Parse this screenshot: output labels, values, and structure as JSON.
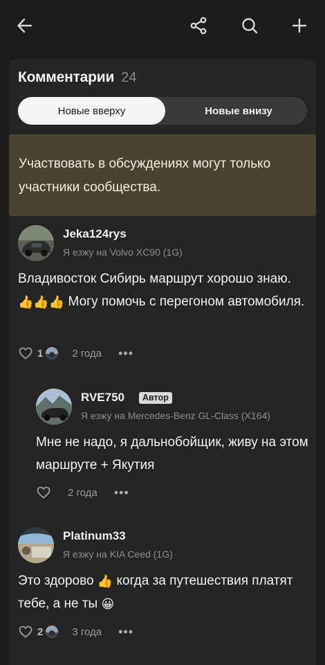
{
  "header": {
    "back_icon": "arrow-left-icon",
    "share_icon": "share-icon",
    "search_icon": "search-icon",
    "add_icon": "plus-icon"
  },
  "comments_section": {
    "title": "Комментарии",
    "count": "24",
    "sort": {
      "newest_first": "Новые вверху",
      "oldest_first": "Новые внизу",
      "selected": "Новые вверху"
    },
    "notice": "Участвовать в обсуждениях могут только участники сообщества."
  },
  "comments": [
    {
      "username": "Jeka124rys",
      "car": "Я езжу на Volvo XC90 (1G)",
      "text_a": "Владивосток Сибирь маршрут хорошо знаю.",
      "emoji_a": "👍👍👍",
      "text_b": " Могу помочь с перегоном автомобиля.",
      "likes": "1",
      "time": "2 года",
      "more": "•••"
    },
    {
      "username": "RVE750",
      "badge": "Автор",
      "car": "Я езжу на Mercedes-Benz GL-Class (X164)",
      "text": "Мне не надо, я дальнобойщик, живу на этом маршруте + Якутия",
      "time": "2 года",
      "more": "•••"
    },
    {
      "username": "Platinum33",
      "car": "Я езжу на KIA Ceed (1G)",
      "text_a": "Это здорово ",
      "emoji_a": "👍",
      "text_b": " когда за путешествия платят тебе, а не ты ",
      "emoji_b": "😀",
      "likes": "2",
      "time": "3 года",
      "more": "•••"
    }
  ],
  "colors": {
    "background": "#1c1c1c",
    "card": "#252525",
    "notice_bg": "#4a4331",
    "segment_active": "#f4f4f4"
  }
}
